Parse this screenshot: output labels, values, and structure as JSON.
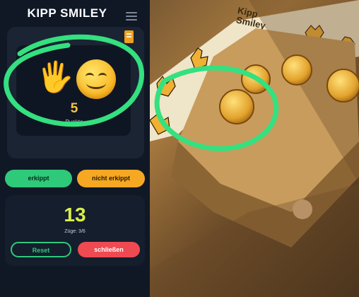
{
  "app": {
    "title": "KIPP SMILEY",
    "score_value": "5",
    "score_label": "Punkte",
    "tipped_button": "erkippt",
    "not_tipped_button": "nicht erkippt",
    "moves_value": "13",
    "moves_label": "Züge: 3/6",
    "reset_button": "Reset",
    "close_button": "schließen"
  },
  "photo": {
    "board_label_line1": "Kipp",
    "board_label_line2": "Smiley"
  },
  "colors": {
    "green": "#2fc97a",
    "orange": "#f6a823",
    "red": "#ef4a52",
    "score_yellow": "#f5c342",
    "moves_lime": "#d8ef4b",
    "highlight_ring": "#34e07f"
  },
  "icons": [
    "hamburger-menu-icon",
    "book-icon",
    "hand-icon",
    "smiley-face-icon"
  ]
}
